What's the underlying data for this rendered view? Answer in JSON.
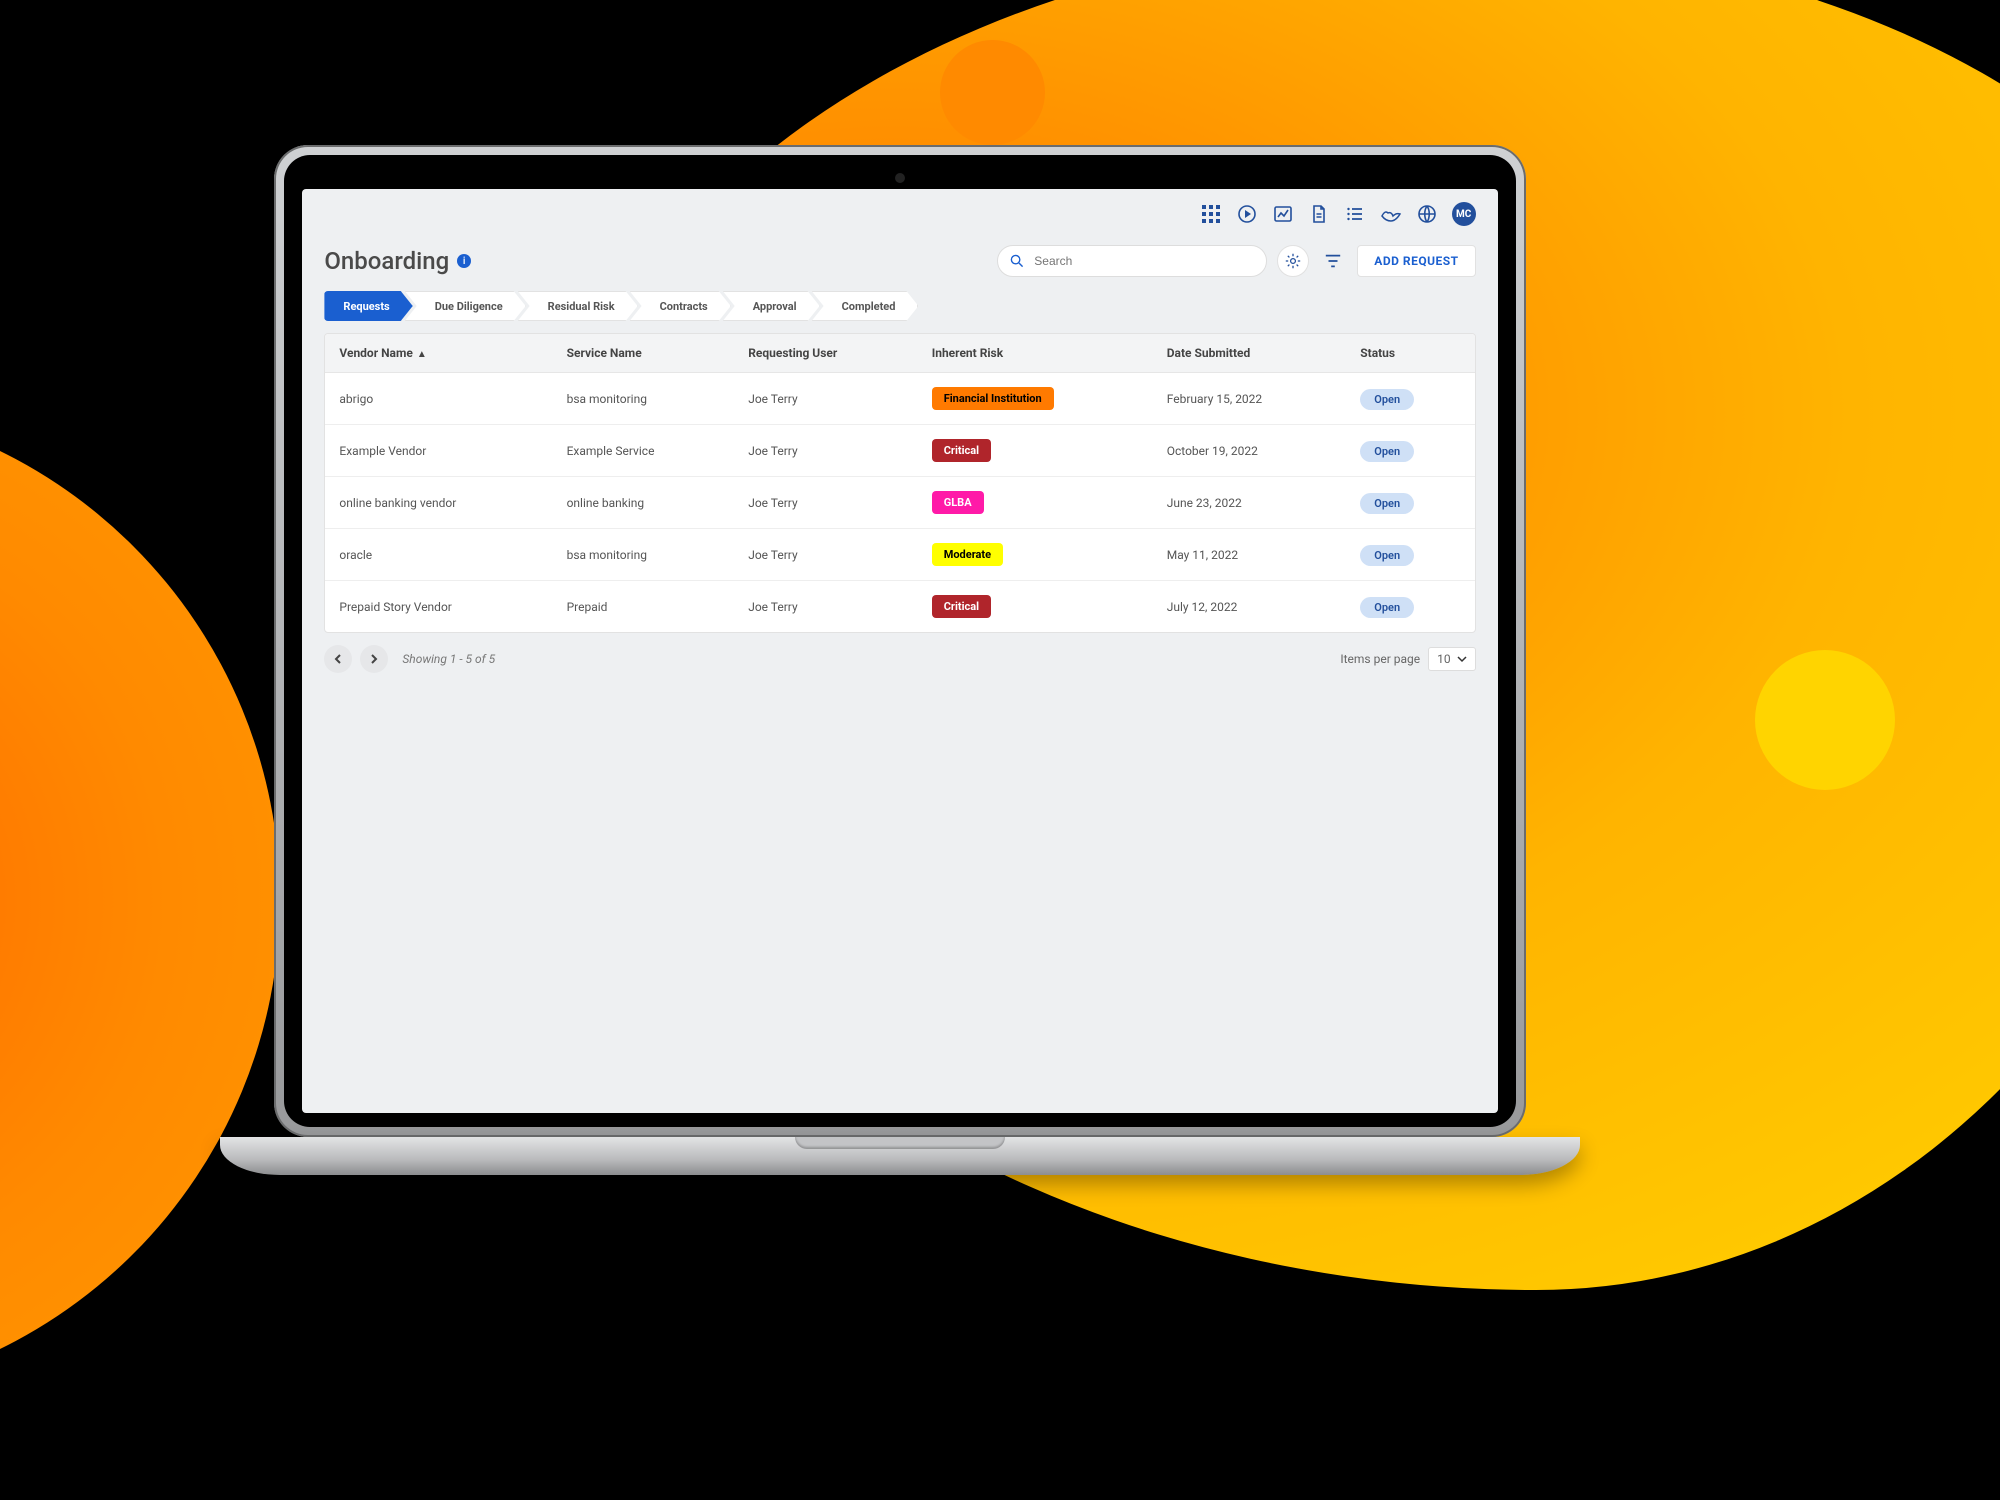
{
  "page": {
    "title": "Onboarding"
  },
  "topbar": {
    "icons": [
      "apps-grid-icon",
      "play-circle-icon",
      "chart-icon",
      "document-icon",
      "list-icon",
      "hand-icon",
      "globe-icon"
    ],
    "avatar": "MC"
  },
  "search": {
    "placeholder": "Search"
  },
  "actions": {
    "add_request": "ADD REQUEST"
  },
  "steps": [
    {
      "label": "Requests",
      "active": true
    },
    {
      "label": "Due Diligence",
      "active": false
    },
    {
      "label": "Residual Risk",
      "active": false
    },
    {
      "label": "Contracts",
      "active": false
    },
    {
      "label": "Approval",
      "active": false
    },
    {
      "label": "Completed",
      "active": false
    }
  ],
  "table": {
    "columns": [
      "Vendor Name",
      "Service Name",
      "Requesting User",
      "Inherent Risk",
      "Date Submitted",
      "Status"
    ],
    "sort_col": 0,
    "sort_dir": "asc",
    "rows": [
      {
        "vendor": "abrigo",
        "service": "bsa monitoring",
        "user": "Joe Terry",
        "risk": {
          "label": "Financial Institution",
          "bg": "#ff7a00",
          "fg": "#000"
        },
        "date": "February 15, 2022",
        "status": "Open"
      },
      {
        "vendor": "Example Vendor",
        "service": "Example Service",
        "user": "Joe Terry",
        "risk": {
          "label": "Critical",
          "bg": "#b0252b",
          "fg": "#fff"
        },
        "date": "October 19, 2022",
        "status": "Open"
      },
      {
        "vendor": "online banking vendor",
        "service": "online banking",
        "user": "Joe Terry",
        "risk": {
          "label": "GLBA",
          "bg": "#ff1aa8",
          "fg": "#fff"
        },
        "date": "June 23, 2022",
        "status": "Open"
      },
      {
        "vendor": "oracle",
        "service": "bsa monitoring",
        "user": "Joe Terry",
        "risk": {
          "label": "Moderate",
          "bg": "#ffff00",
          "fg": "#000"
        },
        "date": "May 11, 2022",
        "status": "Open"
      },
      {
        "vendor": "Prepaid Story Vendor",
        "service": "Prepaid",
        "user": "Joe Terry",
        "risk": {
          "label": "Critical",
          "bg": "#b0252b",
          "fg": "#fff"
        },
        "date": "July 12, 2022",
        "status": "Open"
      }
    ]
  },
  "pager": {
    "summary": "Showing 1 - 5 of 5",
    "items_per_page_label": "Items per page",
    "items_per_page_value": "10"
  }
}
